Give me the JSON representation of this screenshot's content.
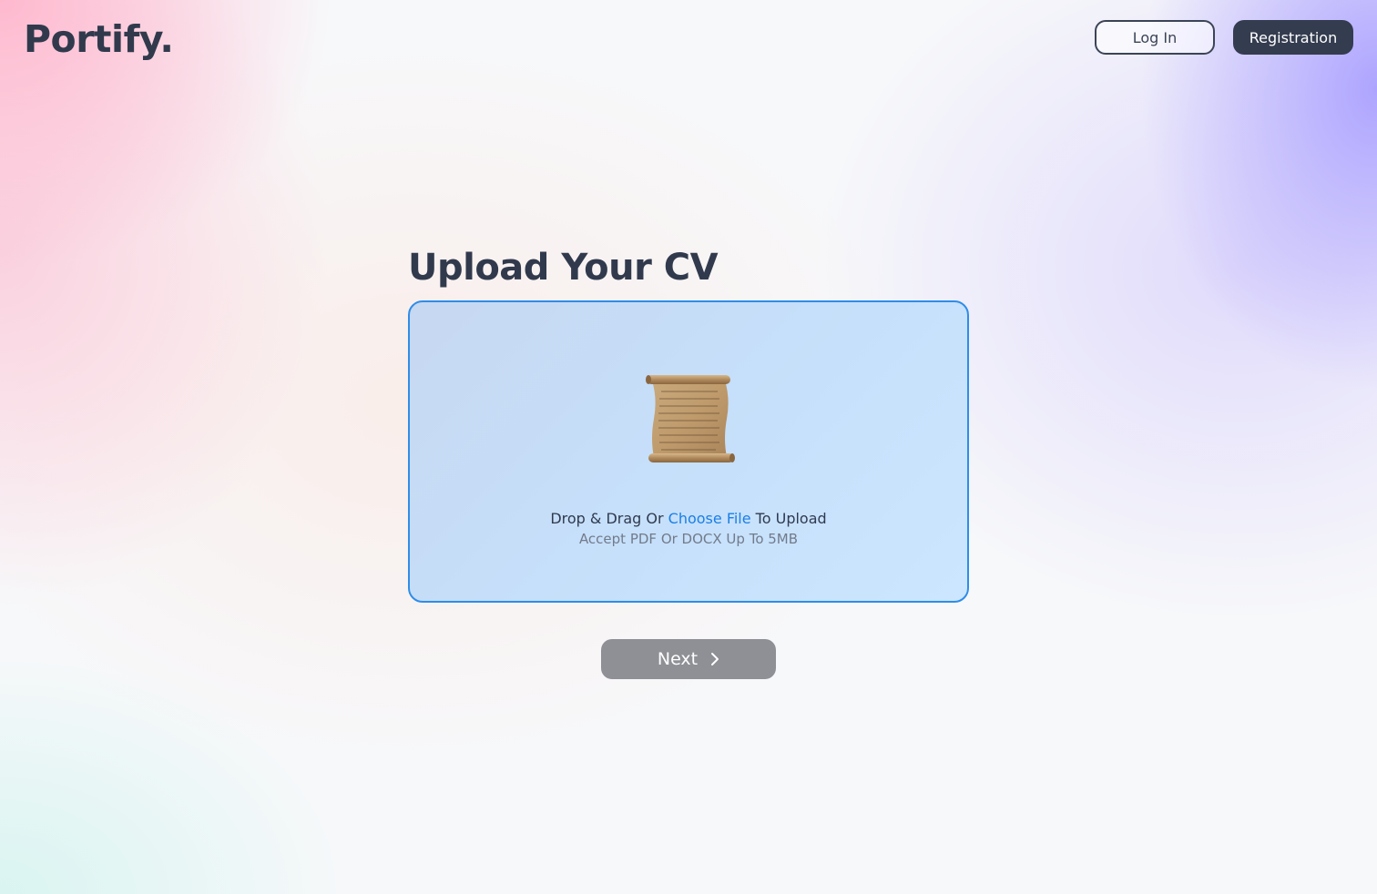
{
  "header": {
    "logo_text": "Portify.",
    "login_label": "Log In",
    "register_label": "Registration"
  },
  "main": {
    "title": "Upload Your CV",
    "dropzone": {
      "icon": "scroll-document-icon",
      "text_before": "Drop & Drag Or ",
      "link_text": "Choose File",
      "text_after": " To Upload",
      "accept_text": "Accept PDF Or DOCX Up To 5MB"
    },
    "next_label": "Next",
    "next_icon": "chevron-right-icon"
  },
  "colors": {
    "accent_blue": "#1a7fe6",
    "dropzone_border": "#2f8de8",
    "dark_navy": "#343c4f",
    "next_button_disabled": "#8f9096"
  }
}
